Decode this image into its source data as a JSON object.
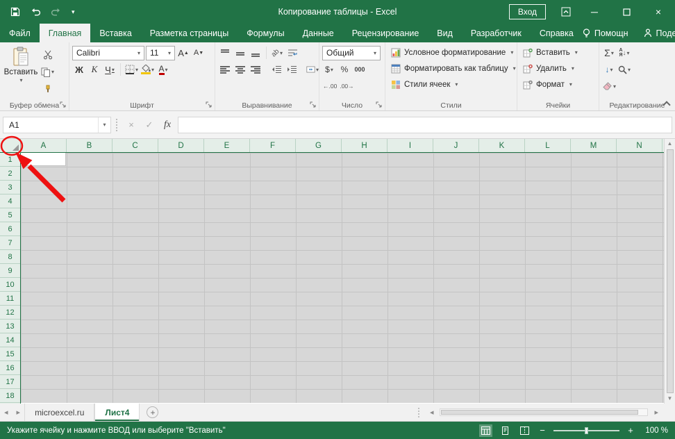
{
  "title_bar": {
    "title": "Копирование таблицы  -  Excel",
    "sign_in": "Вход"
  },
  "ribbon_tabs": {
    "file": "Файл",
    "home": "Главная",
    "insert": "Вставка",
    "page_layout": "Разметка страницы",
    "formulas": "Формулы",
    "data": "Данные",
    "review": "Рецензирование",
    "view": "Вид",
    "developer": "Разработчик",
    "help": "Справка",
    "assistant": "Помощн",
    "share": "Поделиться"
  },
  "ribbon": {
    "clipboard": {
      "paste_label": "Вставить",
      "group_label": "Буфер обмена"
    },
    "font": {
      "family": "Calibri",
      "size": "11",
      "bold": "Ж",
      "italic": "К",
      "underline": "Ч",
      "grow": "А",
      "shrink": "А",
      "color": "А",
      "group_label": "Шрифт"
    },
    "alignment": {
      "orientation": "ab",
      "group_label": "Выравнивание"
    },
    "number": {
      "format": "Общий",
      "currency": "$",
      "percent": "%",
      "thousands": "000",
      "inc_decimal": "←.00",
      "dec_decimal": ".00→",
      "group_label": "Число"
    },
    "styles": {
      "conditional": "Условное форматирование",
      "as_table": "Форматировать как таблицу",
      "cell_styles": "Стили ячеек",
      "group_label": "Стили"
    },
    "cells": {
      "insert": "Вставить",
      "delete": "Удалить",
      "format": "Формат",
      "group_label": "Ячейки"
    },
    "editing": {
      "autosum": "Σ",
      "fill": "↓",
      "sort_a": "А",
      "sort_b": "Я",
      "group_label": "Редактирование"
    }
  },
  "formula_bar": {
    "name_box": "A1",
    "cancel": "×",
    "enter": "✓",
    "fx": "fx"
  },
  "grid": {
    "column_headers": [
      "A",
      "B",
      "C",
      "D",
      "E",
      "F",
      "G",
      "H",
      "I",
      "J",
      "K",
      "L",
      "M",
      "N"
    ],
    "row_headers": [
      "1",
      "2",
      "3",
      "4",
      "5",
      "6",
      "7",
      "8",
      "9",
      "10",
      "11",
      "12",
      "13",
      "14",
      "15",
      "16",
      "17",
      "18"
    ],
    "active_cell": "A1"
  },
  "sheet_tabs": {
    "prev": "◂",
    "next": "▸",
    "sheet1": "microexcel.ru",
    "sheet2": "Лист4",
    "add": "+"
  },
  "status_bar": {
    "message": "Укажите ячейку и нажмите ВВОД или выберите \"Вставить\"",
    "zoom_out": "−",
    "zoom_in": "+",
    "zoom_level": "100 %"
  },
  "colors": {
    "excel_green": "#217346",
    "annotation_red": "#ee1111"
  }
}
